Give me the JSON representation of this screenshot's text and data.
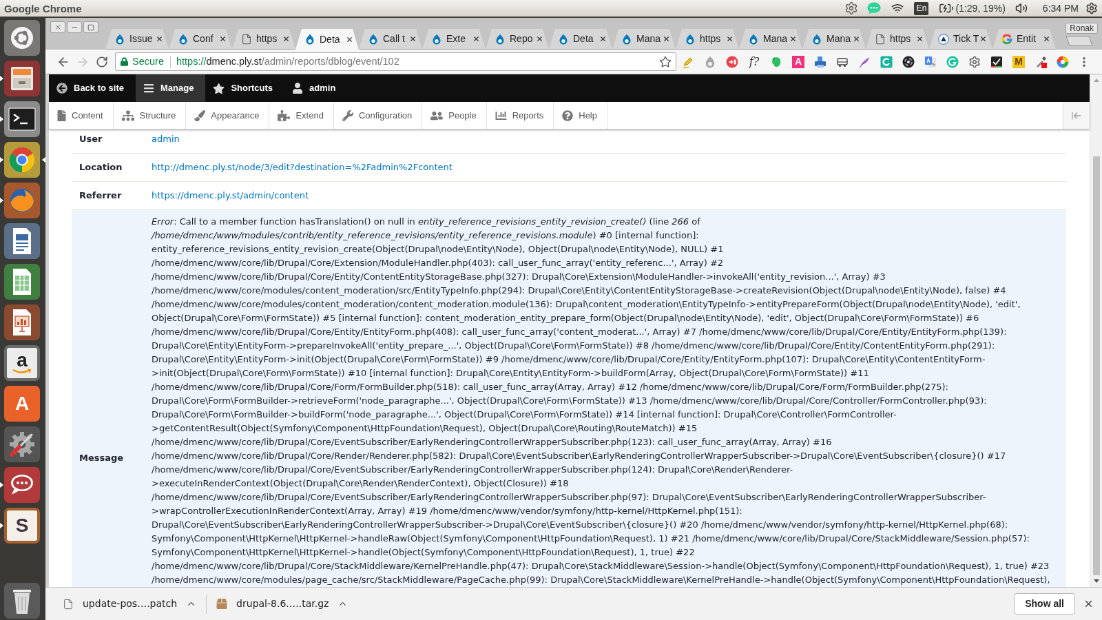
{
  "top_panel": {
    "app_title": "Google Chrome",
    "keyboard_layout": "En",
    "battery": "(1:29, 19%)",
    "clock": "6:34 PM"
  },
  "launcher": [
    {
      "kind": "dash",
      "running": false,
      "focused": false
    },
    {
      "kind": "drawer",
      "running": true,
      "focused": false
    },
    {
      "kind": "terminal",
      "running": true,
      "focused": false
    },
    {
      "kind": "ring",
      "running": true,
      "focused": true
    },
    {
      "kind": "globe",
      "running": true,
      "focused": false
    },
    {
      "kind": "document",
      "running": false,
      "focused": false
    },
    {
      "kind": "spreadsheet",
      "running": false,
      "focused": false
    },
    {
      "kind": "slides",
      "running": false,
      "focused": false
    },
    {
      "kind": "shop",
      "text": "a",
      "running": false,
      "focused": false
    },
    {
      "kind": "bag",
      "text": "A",
      "running": false,
      "focused": false
    },
    {
      "kind": "tools",
      "running": false,
      "focused": false
    },
    {
      "kind": "chat",
      "running": true,
      "focused": false
    },
    {
      "kind": "hash",
      "text": "S",
      "running": true,
      "focused": false
    },
    {
      "kind": "bin",
      "running": false,
      "focused": false
    }
  ],
  "browser": {
    "tabs": [
      {
        "title": "Issue",
        "kind": "drop",
        "selected": false
      },
      {
        "title": "Conf",
        "kind": "drop",
        "selected": false
      },
      {
        "title": "https",
        "kind": "page",
        "selected": false
      },
      {
        "title": "Deta",
        "kind": "drop",
        "selected": true
      },
      {
        "title": "Call t",
        "kind": "drop",
        "selected": false
      },
      {
        "title": "Exte",
        "kind": "drop",
        "selected": false
      },
      {
        "title": "Repo",
        "kind": "drop",
        "selected": false
      },
      {
        "title": "Deta",
        "kind": "drop",
        "selected": false
      },
      {
        "title": "Mana",
        "kind": "drop",
        "selected": false
      },
      {
        "title": "https",
        "kind": "drop",
        "selected": false
      },
      {
        "title": "Mana",
        "kind": "drop",
        "selected": false
      },
      {
        "title": "Mana",
        "kind": "drop",
        "selected": false
      },
      {
        "title": "https",
        "kind": "page",
        "selected": false
      },
      {
        "title": "Tick T",
        "kind": "triangle",
        "selected": false
      },
      {
        "title": "Entit",
        "kind": "ring",
        "selected": false
      }
    ],
    "profile": "Ronak",
    "omnibox": {
      "security": "Secure",
      "scheme": "https://",
      "host": "dmenc.ply.st",
      "path": "/admin/reports/dblog/event/102"
    },
    "extension_labels": [
      "f?",
      "A",
      "M"
    ]
  },
  "toolbar": {
    "items": [
      {
        "label": "Back to site",
        "selected": false
      },
      {
        "label": "Manage",
        "selected": true
      },
      {
        "label": "Shortcuts",
        "selected": false
      },
      {
        "label": "admin",
        "selected": false
      }
    ]
  },
  "tray": {
    "items": [
      {
        "label": "Content"
      },
      {
        "label": "Structure"
      },
      {
        "label": "Appearance"
      },
      {
        "label": "Extend"
      },
      {
        "label": "Configuration"
      },
      {
        "label": "People"
      },
      {
        "label": "Reports"
      },
      {
        "label": "Help"
      }
    ]
  },
  "details": [
    {
      "label": "User",
      "kind": "link",
      "value": "admin",
      "hovered": false
    },
    {
      "label": "Location",
      "kind": "link",
      "value": "http://dmenc.ply.st/node/3/edit?destination=%2Fadmin%2Fcontent",
      "hovered": false
    },
    {
      "label": "Referrer",
      "kind": "link",
      "value": "https://dmenc.ply.st/admin/content",
      "hovered": false
    },
    {
      "label": "Message",
      "kind": "text",
      "hovered": true,
      "value": "*Error*: Call to a member function hasTranslation() on null in *entity_reference_revisions_entity_revision_create()* (line *266* of */home/dmenc/www/modules/contrib/entity_reference_revisions/entity_reference_revisions.module*) #0 [internal function]: entity_reference_revisions_entity_revision_create(Object(Drupal\\node\\Entity\\Node), Object(Drupal\\node\\Entity\\Node), NULL) #1 /home/dmenc/www/core/lib/Drupal/Core/Extension/ModuleHandler.php(403): call_user_func_array('entity_referenc...', Array) #2 /home/dmenc/www/core/lib/Drupal/Core/Entity/ContentEntityStorageBase.php(327): Drupal\\Core\\Extension\\ModuleHandler->invokeAll('entity_revision...', Array) #3 /home/dmenc/www/core/modules/content_moderation/src/EntityTypeInfo.php(294): Drupal\\Core\\Entity\\ContentEntityStorageBase->createRevision(Object(Drupal\\node\\Entity\\Node), false) #4 /home/dmenc/www/core/modules/content_moderation/content_moderation.module(136): Drupal\\content_moderation\\EntityTypeInfo->entityPrepareForm(Object(Drupal\\node\\Entity\\Node), 'edit', Object(Drupal\\Core\\Form\\FormState)) #5 [internal function]: content_moderation_entity_prepare_form(Object(Drupal\\node\\Entity\\Node), 'edit', Object(Drupal\\Core\\Form\\FormState)) #6 /home/dmenc/www/core/lib/Drupal/Core/Entity/EntityForm.php(408): call_user_func_array('content_moderat...', Array) #7 /home/dmenc/www/core/lib/Drupal/Core/Entity/EntityForm.php(139): Drupal\\Core\\Entity\\EntityForm->prepareInvokeAll('entity_prepare_...', Object(Drupal\\Core\\Form\\FormState)) #8 /home/dmenc/www/core/lib/Drupal/Core/Entity/ContentEntityForm.php(291): Drupal\\Core\\Entity\\EntityForm->init(Object(Drupal\\Core\\Form\\FormState)) #9 /home/dmenc/www/core/lib/Drupal/Core/Entity/EntityForm.php(107): Drupal\\Core\\Entity\\ContentEntityForm->init(Object(Drupal\\Core\\Form\\FormState)) #10 [internal function]: Drupal\\Core\\Entity\\EntityForm->buildForm(Array, Object(Drupal\\Core\\Form\\FormState)) #11 /home/dmenc/www/core/lib/Drupal/Core/Form/FormBuilder.php(518): call_user_func_array(Array, Array) #12 /home/dmenc/www/core/lib/Drupal/Core/Form/FormBuilder.php(275): Drupal\\Core\\Form\\FormBuilder->retrieveForm('node_paragraphe...', Object(Drupal\\Core\\Form\\FormState)) #13 /home/dmenc/www/core/lib/Drupal/Core/Controller/FormController.php(93): Drupal\\Core\\Form\\FormBuilder->buildForm('node_paragraphe...', Object(Drupal\\Core\\Form\\FormState)) #14 [internal function]: Drupal\\Core\\Controller\\FormController->getContentResult(Object(Symfony\\Component\\HttpFoundation\\Request), Object(Drupal\\Core\\Routing\\RouteMatch)) #15 /home/dmenc/www/core/lib/Drupal/Core/EventSubscriber/EarlyRenderingControllerWrapperSubscriber.php(123): call_user_func_array(Array, Array) #16 /home/dmenc/www/core/lib/Drupal/Core/Render/Renderer.php(582): Drupal\\Core\\EventSubscriber\\EarlyRenderingControllerWrapperSubscriber->Drupal\\Core\\EventSubscriber\\{closure}() #17 /home/dmenc/www/core/lib/Drupal/Core/EventSubscriber/EarlyRenderingControllerWrapperSubscriber.php(124): Drupal\\Core\\Render\\Renderer->executeInRenderContext(Object(Drupal\\Core\\Render\\RenderContext), Object(Closure)) #18 /home/dmenc/www/core/lib/Drupal/Core/EventSubscriber/EarlyRenderingControllerWrapperSubscriber.php(97): Drupal\\Core\\EventSubscriber\\EarlyRenderingControllerWrapperSubscriber->wrapControllerExecutionInRenderContext(Array, Array) #19 /home/dmenc/www/vendor/symfony/http-kernel/HttpKernel.php(151): Drupal\\Core\\EventSubscriber\\EarlyRenderingControllerWrapperSubscriber->Drupal\\Core\\EventSubscriber\\{closure}() #20 /home/dmenc/www/vendor/symfony/http-kernel/HttpKernel.php(68): Symfony\\Component\\HttpKernel\\HttpKernel->handleRaw(Object(Symfony\\Component\\HttpFoundation\\Request), 1) #21 /home/dmenc/www/core/lib/Drupal/Core/StackMiddleware/Session.php(57): Symfony\\Component\\HttpKernel\\HttpKernel->handle(Object(Symfony\\Component\\HttpFoundation\\Request), 1, true) #22 /home/dmenc/www/core/lib/Drupal/Core/StackMiddleware/KernelPreHandle.php(47): Drupal\\Core\\StackMiddleware\\Session->handle(Object(Symfony\\Component\\HttpFoundation\\Request), 1, true) #23 /home/dmenc/www/core/modules/page_cache/src/StackMiddleware/PageCache.php(99): Drupal\\Core\\StackMiddleware\\KernelPreHandle->handle(Object(Symfony\\Component\\HttpFoundation\\Request),"
    }
  ],
  "downloads": {
    "items": [
      {
        "kind": "file",
        "name": "update-pos….patch"
      },
      {
        "kind": "archive",
        "name": "drupal-8.6.….tar.gz"
      }
    ],
    "show_all": "Show all"
  }
}
